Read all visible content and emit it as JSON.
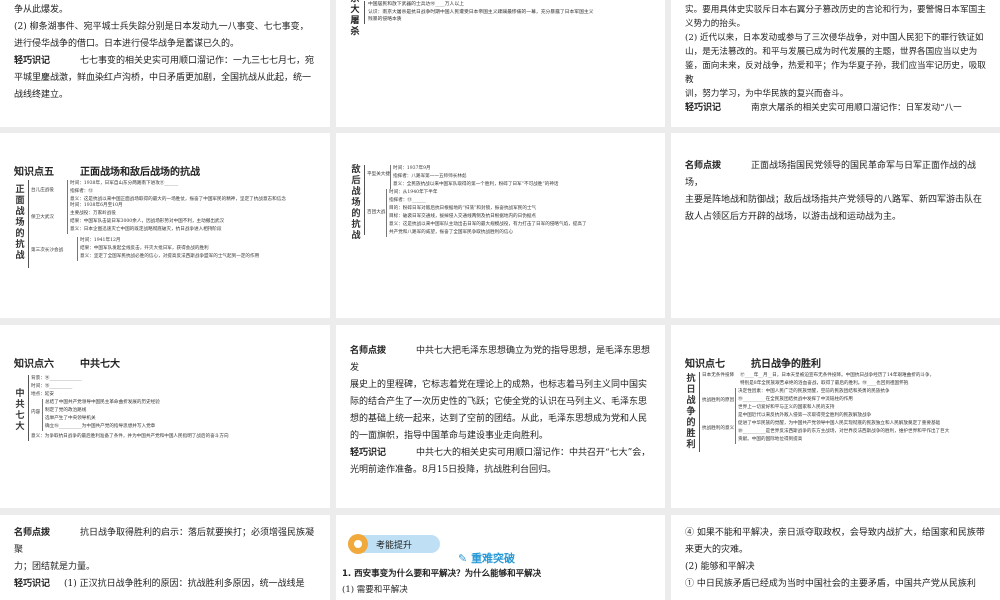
{
  "s1": {
    "l1": "争从此爆发。",
    "l2": "(2) 柳条湖事件、宛平城士兵失踪分别是日本发动九一八事变、七七事变，进行侵华战争的借口。日本进行侵华战争是蓄谋已久的。",
    "tip_label": "轻巧识记",
    "tip": "七七事变的相关史实可用顺口溜记作：一九三七七月七，宛平城里鏖战激，鲜血染红卢沟桥，中日矛盾更加剧，全国抗战从此起，统一战线终建立。"
  },
  "s2": {
    "vlabel": "京大屠杀",
    "l1": "中国居民和放下武器的士兵达⑩____万人以上",
    "l2": "认识：南京大屠杀是抗日战争时期中国人民遭受日本帝国主义蹂躏最惨痛的一幕，充分暴露了日本军国主义",
    "l3": "残暴的侵略本质"
  },
  "s3": {
    "l1": "实。要用具体史实驳斥日本右翼分子篡改历史的言论和行为，要警惕日本军国主义势力的抬头。",
    "l2": "(2) 近代以来，日本发动或参与了三次侵华战争，对中国人民犯下的罪行铁证如山，是无法篡改的。和平与发展已成为时代发展的主题，世界各国应当以史为鉴，面向未来，反对战争，热爱和平；作为华夏子孙，我们应当牢记历史，吸取教",
    "l3": "训，努力学习，为中华民族的复兴而奋斗。",
    "tip_label": "轻巧识记",
    "tip": "南京大屠杀的相关史实可用顺口溜记作：日军发动“八一"
  },
  "s4": {
    "num": "知识点五",
    "title": "正面战场和敌后战场的抗战",
    "vlabel": "正面战场的抗战",
    "groups": [
      {
        "name": "台儿庄战役",
        "items": [
          "时间：1938年，日军自山东分两路南下进攻⑪______",
          "指挥者：⑫",
          "意义：这是抗战以来中国正面战场取得的最大的一场胜仗，振奋了中国军民的精神，坚定了抗战意志和信念"
        ]
      },
      {
        "name": "保卫大武汉",
        "items": [
          "时间：1938年6月至10月",
          "主要战役：万家岭战役",
          "结果：中国军队击毙日军3000余人，因战场形势对中国不利，主动撤出武汉",
          "意义：日本企图迅速灭亡中国的既定战略彻底破灭，抗日战争进入相持阶段"
        ]
      },
      {
        "name": "第三次长沙会战",
        "items": [
          "时间：1941年12月",
          "结果：中国军队发起全线反击，歼灭大批日军，获得会战的胜利",
          "意义：坚定了全国军民抗战必胜的信心，对提高反法西斯战争盟军的士气起到一定的作用"
        ]
      }
    ]
  },
  "s5": {
    "vlabel": "敌后战场的抗战",
    "groups": [
      {
        "name": "平型关大捷",
        "items": [
          "时间：1937年9月",
          "指挥者：八路军第一一五师师长林彪",
          "意义：全民族抗战以来中国军队取得的第一个胜利，粉碎了日军“不可战胜”的神话"
        ]
      },
      {
        "name": "百团大战",
        "items": [
          "时间：从1940年下半年",
          "指挥者：⑬______",
          "目的：粉碎日军对敌后抗日根据地的“扫荡”和封锁，振奋抗战军民的士气",
          "目标：破袭日军交通线，拔掉侵入交通线两侧及抗日根据地内的日伪据点",
          "意义：这是抗战以来中国军队主动出击日军的最大规模战役，有力打击了日军的侵略气焰，提高了",
          "共产党和八路军的威望，振奋了全国军民争取抗战胜利的信心"
        ]
      }
    ]
  },
  "s6": {
    "label": "名师点拨",
    "l1": "正面战场指国民党领导的国民革命军与日军正面作战的战场，",
    "l2": "主要是阵地战和防御战；敌后战场指共产党领导的八路军、新四军游击队在敌人占领区后方开辟的战场，以游击战和运动战为主。"
  },
  "s7": {
    "num": "知识点六",
    "title": "中共七大",
    "vlabel": "中共七大",
    "items": [
      "背景：⑭______________",
      "时间：⑮__________",
      "地点：延安"
    ],
    "content_label": "内容",
    "content": [
      "总结了中国共产党领导中国民主革命曲折发展的历史经验",
      "制定了党的政治路线",
      "选举产生了中央领导机关",
      "确立⑯__________为中国共产党的指导思想并写入党章"
    ],
    "meaning": "意义：为争取抗日战争的最后胜利准备了条件，并为中国共产党和中国人民指明了战后的奋斗方向"
  },
  "s8": {
    "label": "名师点拨",
    "l1": "中共七大把毛泽东思想确立为党的指导思想，是毛泽东思想发",
    "l2": "展史上的里程碑，它标志着党在理论上的成熟，也标志着马列主义同中国实际的结合产生了一次历史性的飞跃；它使全党的认识在马列主义、毛泽东思想的基础上统一起来，达到了空前的团结。从此，毛泽东思想成为党和人民的一面旗帜，指导中国革命与建设事业走向胜利。",
    "tip_label": "轻巧识记",
    "tip": "中共七大的相关史实可用顺口溜记作：中共召开“七大”会，光明前途作准备。8月15日投降，抗战胜利台回归。"
  },
  "s9": {
    "num": "知识点七",
    "title": "抗日战争的胜利",
    "vlabel": "抗日战争的胜利",
    "groups": [
      {
        "name": "日本无条件投降",
        "items": [
          "⑰____年__月__日，日本天皇被迫宣布无条件投降。中国抗日战争经历了14年艰难曲折的斗争，",
          "特别是8年全民族艰苦卓绝的浴血奋战，取得了最后的胜利。⑱____也回到祖国怀抱"
        ]
      },
      {
        "name": "抗战胜利的原因",
        "items": [
          "决定性因素：中国人民广泛的民族觉醒，空前的民族团结和英勇的民族抗争",
          "⑲__________在全民族团结抗战中发挥了中流砥柱的作用",
          "世界上一切爱好和平与正义的国家和人民的支持"
        ]
      },
      {
        "name": "抗战胜利的意义",
        "items": [
          "是中国近代以来反抗外敌入侵第一次取得完全胜利的民族解放战争",
          "促进了中华民族的觉醒，为中国共产党领导中国人民实现彻底的民族独立和人民解放奠定了重要基础",
          "⑳__________是世界反法西斯战争的东方主战场，对世界反法西斯战争的胜利，维护世界和平作出了巨大",
          "贡献。中国的国际地位得到提高"
        ]
      }
    ]
  },
  "s10": {
    "label": "名师点拨",
    "l1": "抗日战争取得胜利的启示：落后就要挨打；必须增强民族凝聚",
    "l2": "力；团结就是力量。",
    "tip_label": "轻巧识记",
    "tip": "(1) 正汉抗日战争胜利的原因：抗战胜利多原因，统一战线是"
  },
  "s11": {
    "pill": "考能提升",
    "badge": "重难突破",
    "q": "1. 西安事变为什么要和平解决？为什么能够和平解决",
    "a": "(1) 需要和平解决"
  },
  "s12": {
    "l1": "④ 如果不能和平解决，亲日派夺取政权，会导致内战扩大，给国家和民族带来更大的灾难。",
    "l2": "(2) 能够和平解决",
    "l3": "① 中日民族矛盾已经成为当时中国社会的主要矛盾，中国共产党从民族利"
  }
}
